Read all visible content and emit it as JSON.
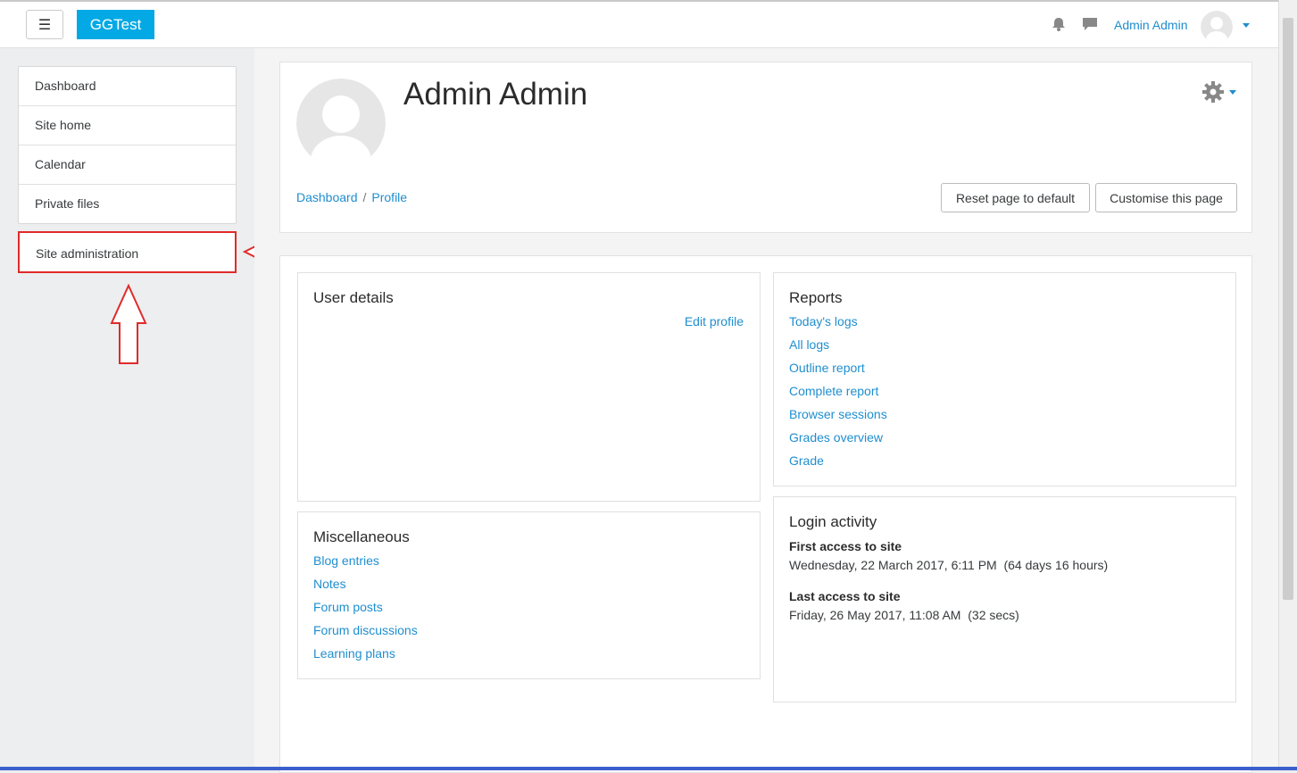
{
  "topbar": {
    "brand": "GGTest",
    "menu_icon": "hamburger-icon",
    "username": "Admin Admin"
  },
  "nav": {
    "items": [
      {
        "label": "Dashboard"
      },
      {
        "label": "Site home"
      },
      {
        "label": "Calendar"
      },
      {
        "label": "Private files"
      }
    ],
    "site_admin": "Site administration"
  },
  "header": {
    "title": "Admin Admin",
    "breadcrumb": [
      "Dashboard",
      "Profile"
    ],
    "reset_button": "Reset page to default",
    "customise_button": "Customise this page"
  },
  "user_details": {
    "title": "User details",
    "edit_profile": "Edit profile"
  },
  "reports": {
    "title": "Reports",
    "links": [
      "Today's logs",
      "All logs",
      "Outline report",
      "Complete report",
      "Browser sessions",
      "Grades overview",
      "Grade"
    ]
  },
  "misc": {
    "title": "Miscellaneous",
    "links": [
      "Blog entries",
      "Notes",
      "Forum posts",
      "Forum discussions",
      "Learning plans"
    ]
  },
  "login": {
    "title": "Login activity",
    "first_label": "First access to site",
    "first_value": "Wednesday, 22 March 2017, 6:11 PM  (64 days 16 hours)",
    "last_label": "Last access to site",
    "last_value": "Friday, 26 May 2017, 11:08 AM  (32 secs)"
  },
  "colors": {
    "brand": "#03a9e4",
    "link": "#1f8ecf",
    "highlight": "#e02a2a"
  }
}
